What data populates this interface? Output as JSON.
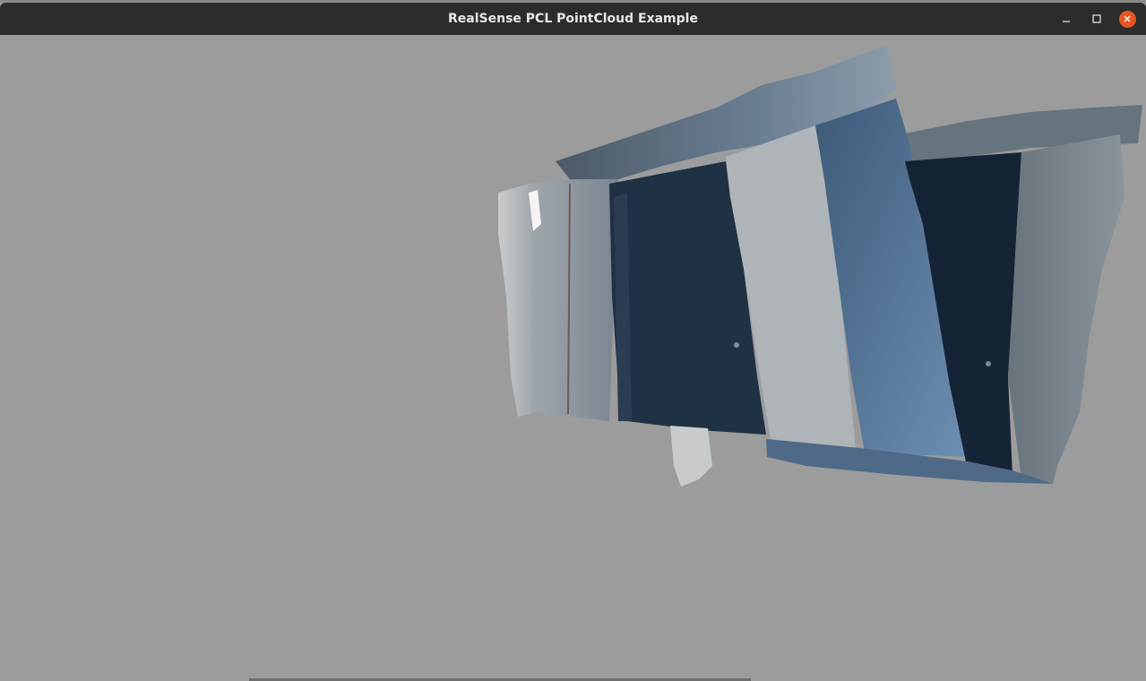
{
  "window": {
    "title": "RealSense PCL PointCloud Example"
  },
  "icons": {
    "minimize": "minimize-icon",
    "maximize": "maximize-icon",
    "close": "close-icon"
  },
  "colors": {
    "background": "#9c9c9c",
    "titlebar": "#2c2c2c",
    "close_button": "#e95420"
  }
}
